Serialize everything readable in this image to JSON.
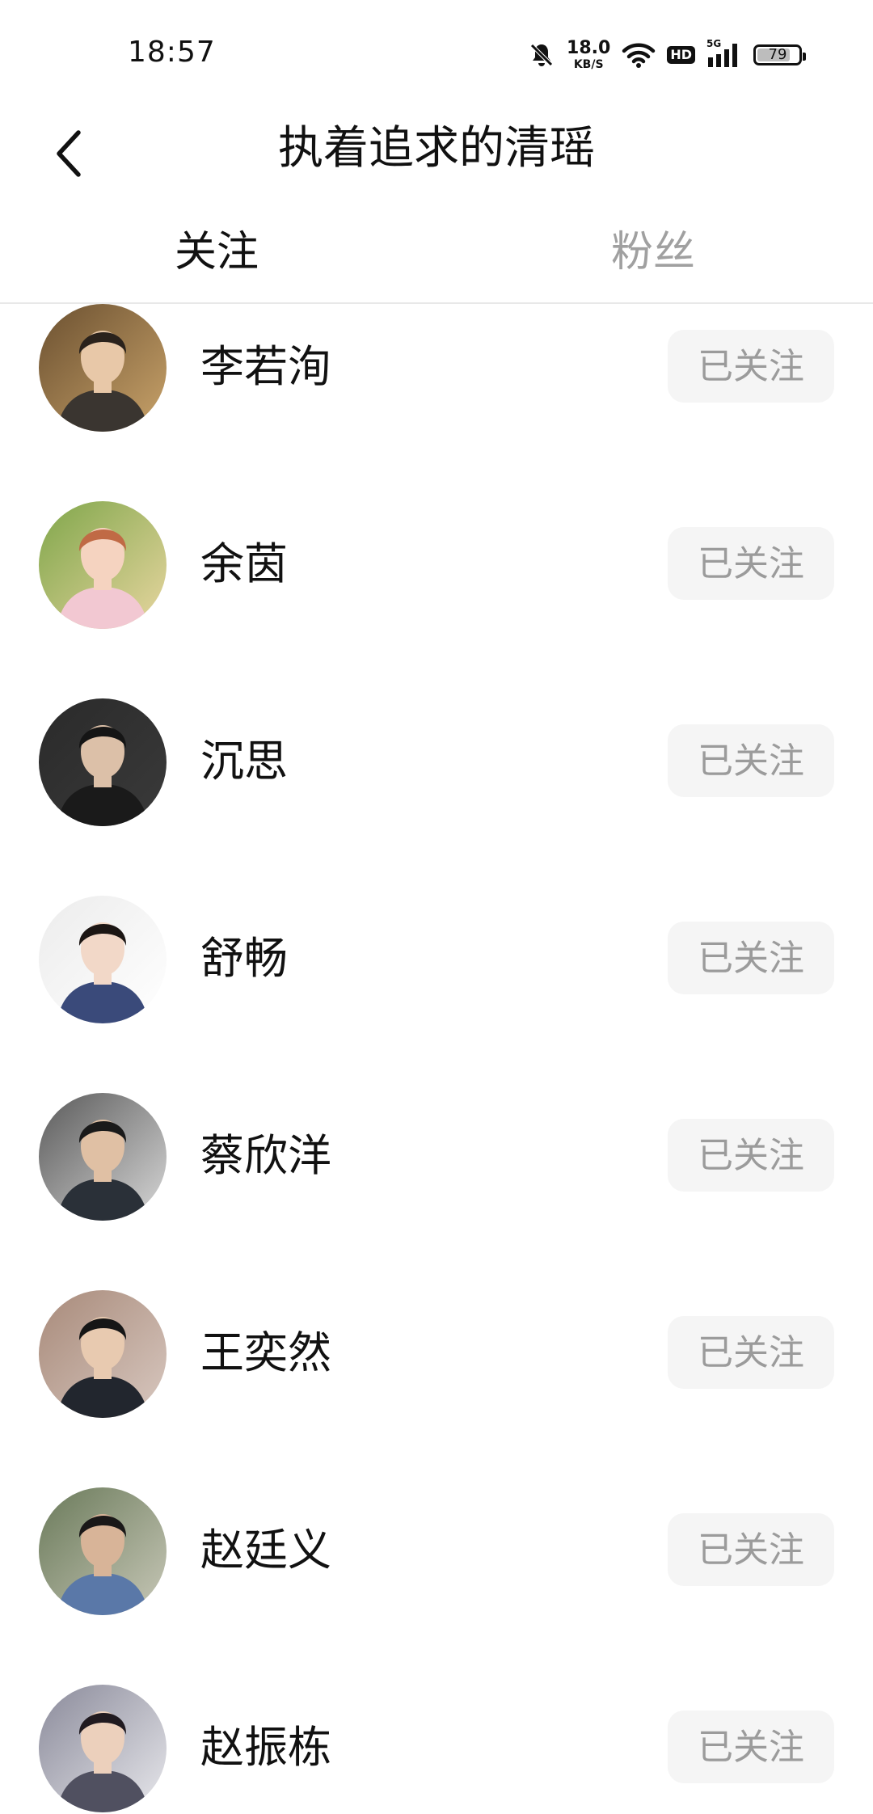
{
  "status_bar": {
    "time": "18:57",
    "net_speed_value": "18.0",
    "net_speed_unit": "KB/S",
    "hd_label": "HD",
    "signal_label": "5G",
    "battery_percent": "79",
    "battery_level": 0.79
  },
  "header": {
    "title": "执着追求的清瑶"
  },
  "tabs": [
    {
      "label": "关注",
      "active": true
    },
    {
      "label": "粉丝",
      "active": false
    }
  ],
  "colors": {
    "active_tab": "#111111",
    "inactive_tab": "#a0a0a0",
    "button_bg": "#f5f5f5",
    "button_text": "#9b9b9b"
  },
  "list": [
    {
      "name": "李若洵",
      "button": "已关注",
      "avatar_icon": "avatar-photo"
    },
    {
      "name": "余茵",
      "button": "已关注",
      "avatar_icon": "avatar-photo"
    },
    {
      "name": "沉思",
      "button": "已关注",
      "avatar_icon": "avatar-photo"
    },
    {
      "name": "舒畅",
      "button": "已关注",
      "avatar_icon": "avatar-photo"
    },
    {
      "name": "蔡欣洋",
      "button": "已关注",
      "avatar_icon": "avatar-photo"
    },
    {
      "name": "王奕然",
      "button": "已关注",
      "avatar_icon": "avatar-photo"
    },
    {
      "name": "赵廷义",
      "button": "已关注",
      "avatar_icon": "avatar-photo"
    },
    {
      "name": "赵振栋",
      "button": "已关注",
      "avatar_icon": "avatar-photo"
    }
  ]
}
